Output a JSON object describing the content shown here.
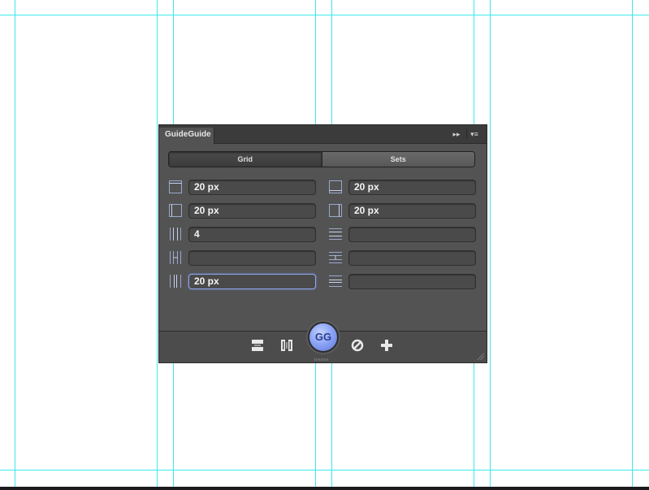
{
  "panel": {
    "title": "GuideGuide",
    "collapse_glyph": "▸▸",
    "menu_glyph": "▾≡"
  },
  "tabs": [
    {
      "label": "Grid",
      "active": true
    },
    {
      "label": "Sets",
      "active": false
    }
  ],
  "columns_left": [
    {
      "icon": "margin-top-icon",
      "value": "20 px"
    },
    {
      "icon": "margin-left-icon",
      "value": "20 px"
    },
    {
      "icon": "columns-icon",
      "value": "4"
    },
    {
      "icon": "column-width-icon",
      "value": ""
    },
    {
      "icon": "column-gutter-icon",
      "value": "20 px",
      "focused": true
    }
  ],
  "columns_right": [
    {
      "icon": "margin-bottom-icon",
      "value": "20 px"
    },
    {
      "icon": "margin-right-icon",
      "value": "20 px"
    },
    {
      "icon": "rows-icon",
      "value": ""
    },
    {
      "icon": "row-height-icon",
      "value": ""
    },
    {
      "icon": "row-gutter-icon",
      "value": ""
    }
  ],
  "toolbar": {
    "gg_label": "GG",
    "buttons": [
      "horizontal-midpoint-icon",
      "vertical-midpoint-icon",
      "clear-guides-icon",
      "add-guide-icon"
    ]
  },
  "colors": {
    "guide": "#3ee8ea",
    "panel_bg": "#535353",
    "accent": "#8ea6f6"
  }
}
